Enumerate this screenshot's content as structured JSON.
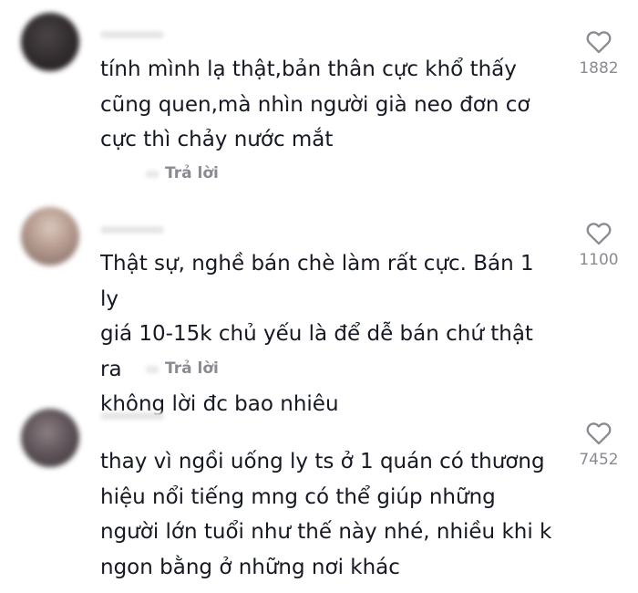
{
  "comments": [
    {
      "text": "tính mình lạ thật,bản thân cực khổ thấy\ncũng quen,mà nhìn người già neo đơn cơ\ncực thì chảy nước mắt",
      "reply_label": "Trả lời",
      "likes": "1882",
      "avatar_color": "#2f2a2b"
    },
    {
      "text": "Thật sự, nghề bán chè làm rất cực. Bán 1 ly\ngiá 10-15k chủ yếu là để dễ bán chứ thật ra\nkhông lời đc bao nhiêu",
      "reply_label": "Trả lời",
      "likes": "1100",
      "avatar_color": "#b59a8e"
    },
    {
      "text": "thay vì ngồi uống ly ts ở 1 quán có thương\nhiệu nổi tiếng mng có thể giúp những\nngười lớn tuổi như thế này nhé, nhiều khi k\nngon bằng ở những nơi khác",
      "likes": "7452",
      "avatar_color": "#5c5257"
    }
  ],
  "colors": {
    "text_primary": "#161823",
    "text_secondary": "#8a8b91",
    "background": "#ffffff"
  }
}
